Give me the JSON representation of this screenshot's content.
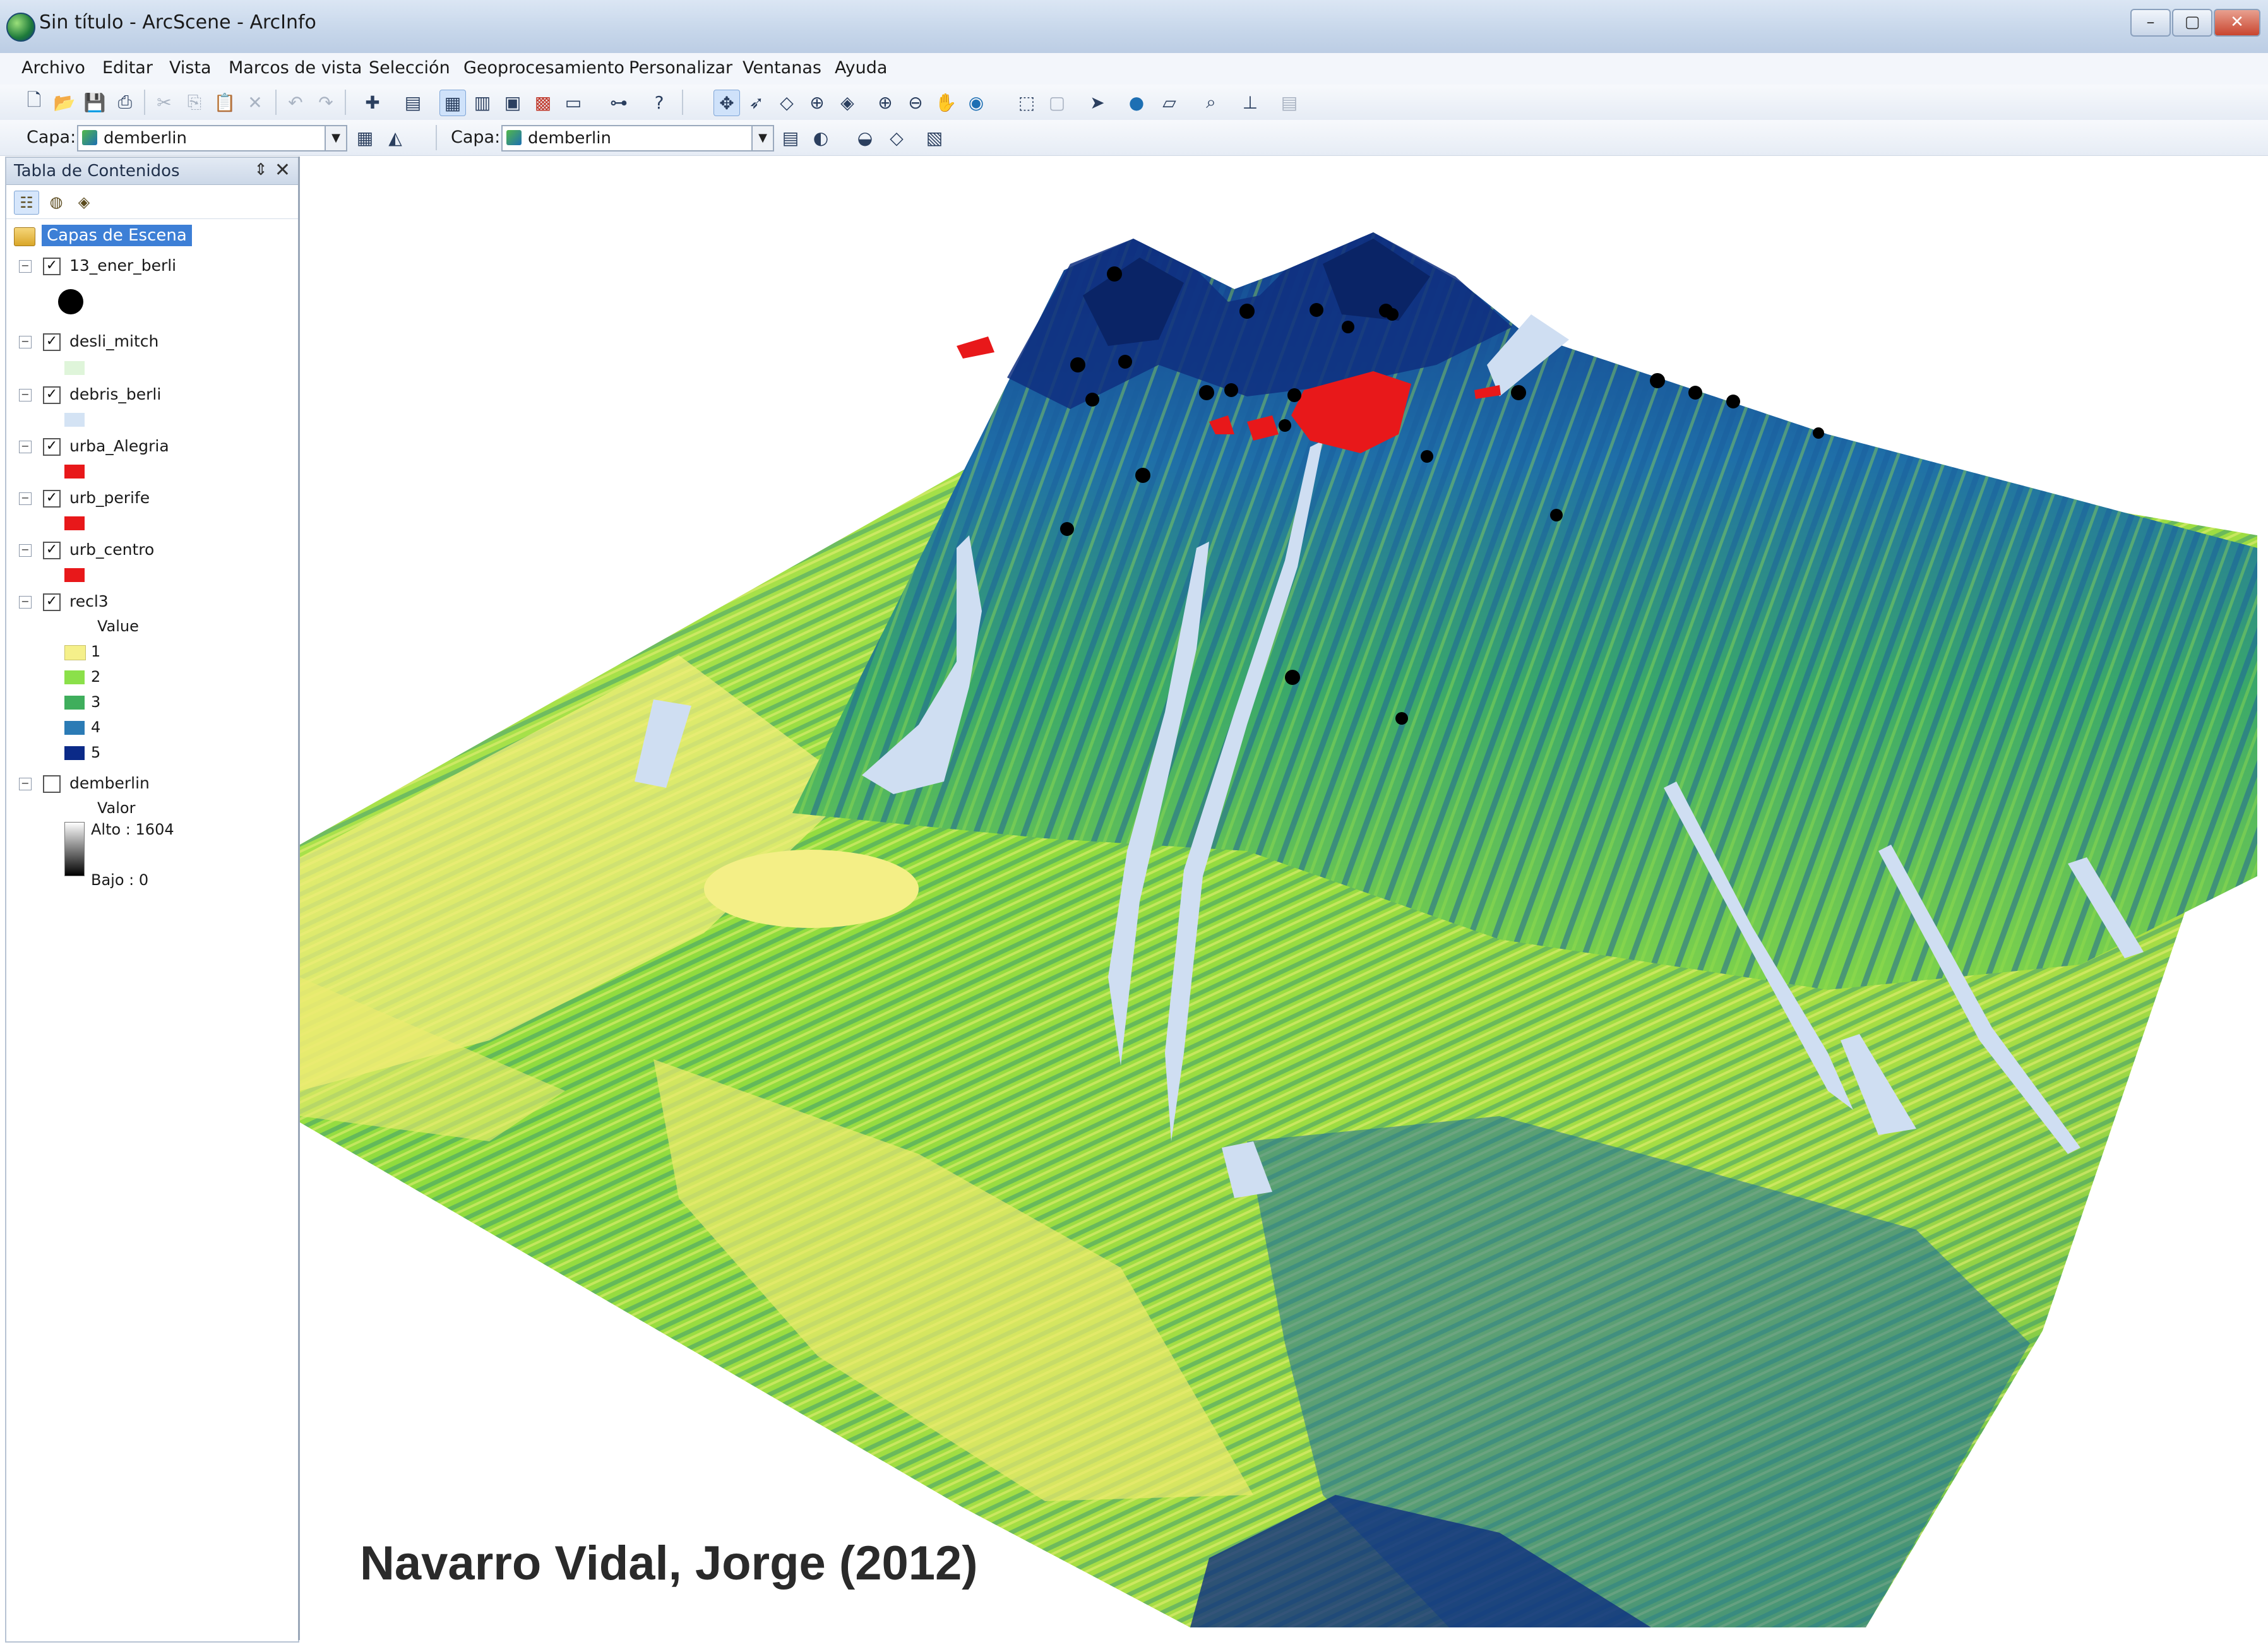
{
  "window": {
    "title": "Sin título - ArcScene - ArcInfo",
    "controls": [
      "–",
      "▢",
      "✕"
    ]
  },
  "menu": [
    "Archivo",
    "Editar",
    "Vista",
    "Marcos de vista",
    "Selección",
    "Geoprocesamiento",
    "Personalizar",
    "Ventanas",
    "Ayuda"
  ],
  "layer_toolbar": {
    "capa_label_1": "Capa:",
    "capa_value_1": "demberlin",
    "capa_label_2": "Capa:",
    "capa_value_2": "demberlin"
  },
  "toc": {
    "title": "Tabla de Contenidos",
    "pin": "⇕",
    "close": "✕",
    "root": "Capas de Escena",
    "layers": [
      {
        "name": "13_ener_berli",
        "checked": "✓",
        "expander": "−"
      },
      {
        "name": "desli_mitch",
        "checked": "✓",
        "expander": "−"
      },
      {
        "name": "debris_berli",
        "checked": "✓",
        "expander": "−"
      },
      {
        "name": "urba_Alegria",
        "checked": "✓",
        "expander": "−"
      },
      {
        "name": "urb_perife",
        "checked": "✓",
        "expander": "−"
      },
      {
        "name": "urb_centro",
        "checked": "✓",
        "expander": "−"
      },
      {
        "name": "recl3",
        "checked": "✓",
        "expander": "−"
      },
      {
        "name": "demberlin",
        "checked": "",
        "expander": "−"
      }
    ],
    "recl3_legend": {
      "heading": "Value",
      "classes": [
        "1",
        "2",
        "3",
        "4",
        "5"
      ],
      "colors": [
        "#f5f08a",
        "#8be04a",
        "#3fae5c",
        "#2b7bb5",
        "#0b2a88"
      ]
    },
    "demberlin_legend": {
      "heading": "Valor",
      "high": "Alto : 1604",
      "low": "Bajo : 0"
    }
  },
  "scene": {
    "credit": "Navarro Vidal, Jorge  (2012)"
  }
}
